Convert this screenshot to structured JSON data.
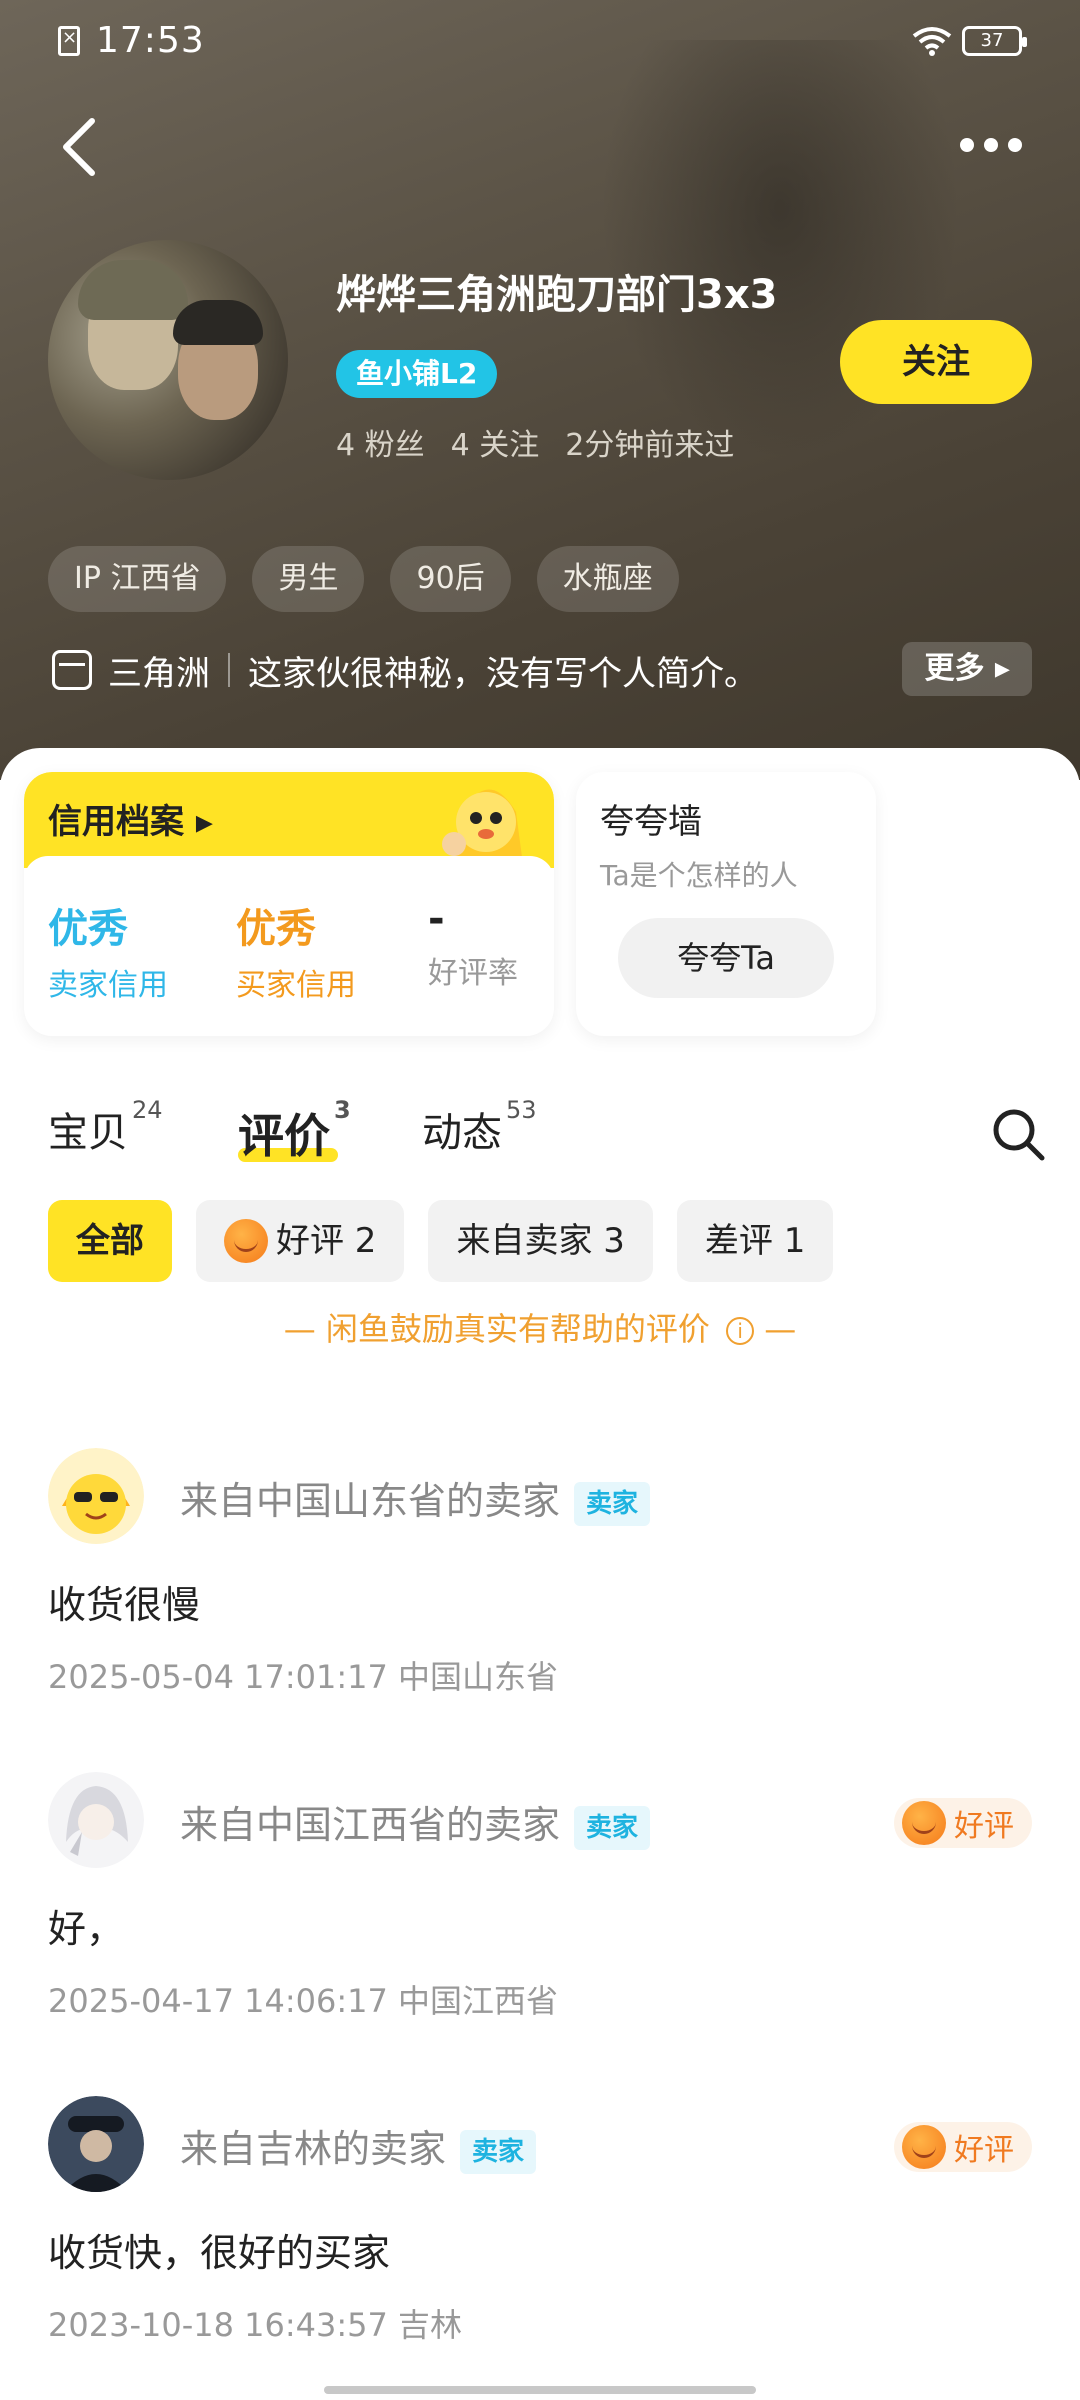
{
  "status_bar": {
    "time": "17:53",
    "battery": "37"
  },
  "profile": {
    "username": "烨烨三角洲跑刀部门3x3",
    "shop_badge": "鱼小铺L2",
    "follow_label": "关注",
    "stats": {
      "fans": "4 粉丝",
      "following": "4 关注",
      "last_seen": "2分钟前来过"
    },
    "tags": [
      "IP 江西省",
      "男生",
      "90后",
      "水瓶座"
    ],
    "intro": {
      "game": "三角洲",
      "text": "这家伙很神秘，没有写个人简介。",
      "more_label": "更多"
    }
  },
  "credit": {
    "title": "信用档案",
    "seller": {
      "value": "优秀",
      "label": "卖家信用"
    },
    "buyer": {
      "value": "优秀",
      "label": "买家信用"
    },
    "rate": {
      "value": "-",
      "label": "好评率"
    },
    "colors": {
      "seller": "#2fb7e8",
      "buyer": "#f39a1e",
      "rate": "#222222"
    }
  },
  "praise": {
    "title": "夸夸墙",
    "subtitle": "Ta是个怎样的人",
    "button": "夸夸Ta"
  },
  "tabs": [
    {
      "label": "宝贝",
      "count": "24"
    },
    {
      "label": "评价",
      "count": "3"
    },
    {
      "label": "动态",
      "count": "53"
    }
  ],
  "filters": [
    {
      "label": "全部"
    },
    {
      "label": "好评 2"
    },
    {
      "label": "来自卖家 3"
    },
    {
      "label": "差评 1"
    }
  ],
  "notice": "— 闲鱼鼓励真实有帮助的评价",
  "notice_tail": "—",
  "reviews": [
    {
      "from": "来自中国山东省的卖家",
      "role": "卖家",
      "rating": "",
      "text": "收货很慢",
      "meta": "2025-05-04 17:01:17 中国山东省"
    },
    {
      "from": "来自中国江西省的卖家",
      "role": "卖家",
      "rating": "好评",
      "text": "好，",
      "meta": "2025-04-17 14:06:17 中国江西省"
    },
    {
      "from": "来自吉林的卖家",
      "role": "卖家",
      "rating": "好评",
      "text": "收货快，很好的买家",
      "meta": "2023-10-18 16:43:57 吉林"
    }
  ],
  "colors": {
    "accent": "#ffe325",
    "seller_tag": "#1eb3e0",
    "good_tag": "#f07a20"
  }
}
